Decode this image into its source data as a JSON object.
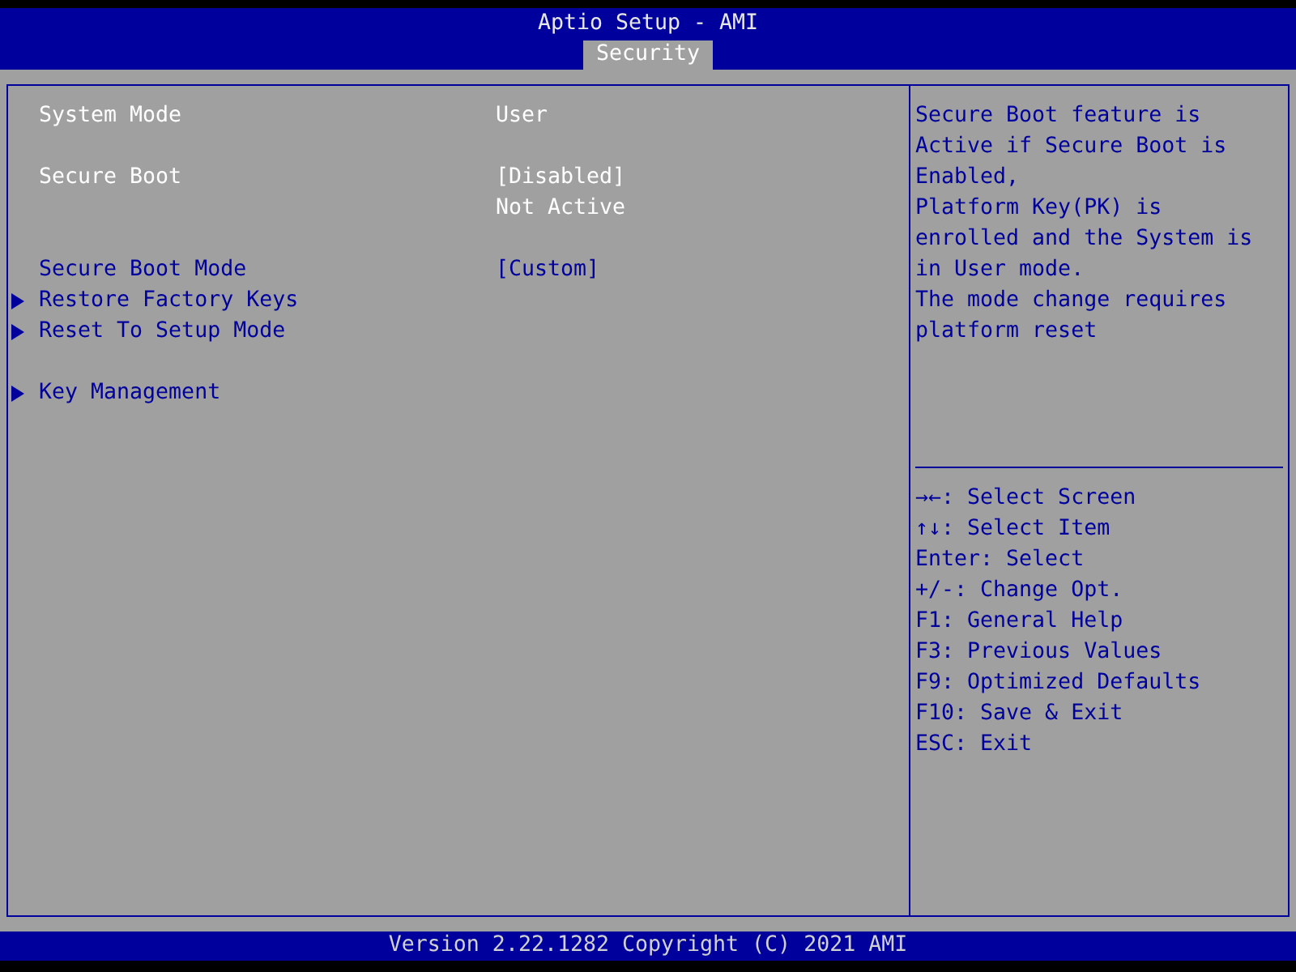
{
  "header": {
    "title": "Aptio Setup - AMI",
    "tabs": [
      {
        "label": "Security",
        "selected": true
      }
    ]
  },
  "groups": [
    [
      {
        "kind": "info",
        "label": "System Mode",
        "value": "User"
      }
    ],
    [
      {
        "kind": "info",
        "label": "Secure Boot",
        "value": "[Disabled]"
      },
      {
        "kind": "info",
        "value": "Not Active"
      }
    ],
    [
      {
        "kind": "setting",
        "label": "Secure Boot Mode",
        "value": "[Custom]"
      },
      {
        "kind": "submenu",
        "label": "Restore Factory Keys"
      },
      {
        "kind": "submenu",
        "label": "Reset To Setup Mode"
      }
    ],
    [
      {
        "kind": "submenu",
        "label": "Key Management"
      }
    ]
  ],
  "help": [
    "Secure Boot feature is",
    "Active if Secure Boot is",
    "Enabled,",
    "Platform Key(PK) is",
    "enrolled and the System is",
    "in User mode.",
    "The mode change requires",
    "platform reset"
  ],
  "keys": [
    "→←: Select Screen",
    "↑↓: Select Item",
    "Enter: Select",
    "+/-: Change Opt.",
    "F1: General Help",
    "F3: Previous Values",
    "F9: Optimized Defaults",
    "F10: Save & Exit",
    "ESC: Exit"
  ],
  "footer": "Version 2.22.1282 Copyright (C) 2021 AMI"
}
